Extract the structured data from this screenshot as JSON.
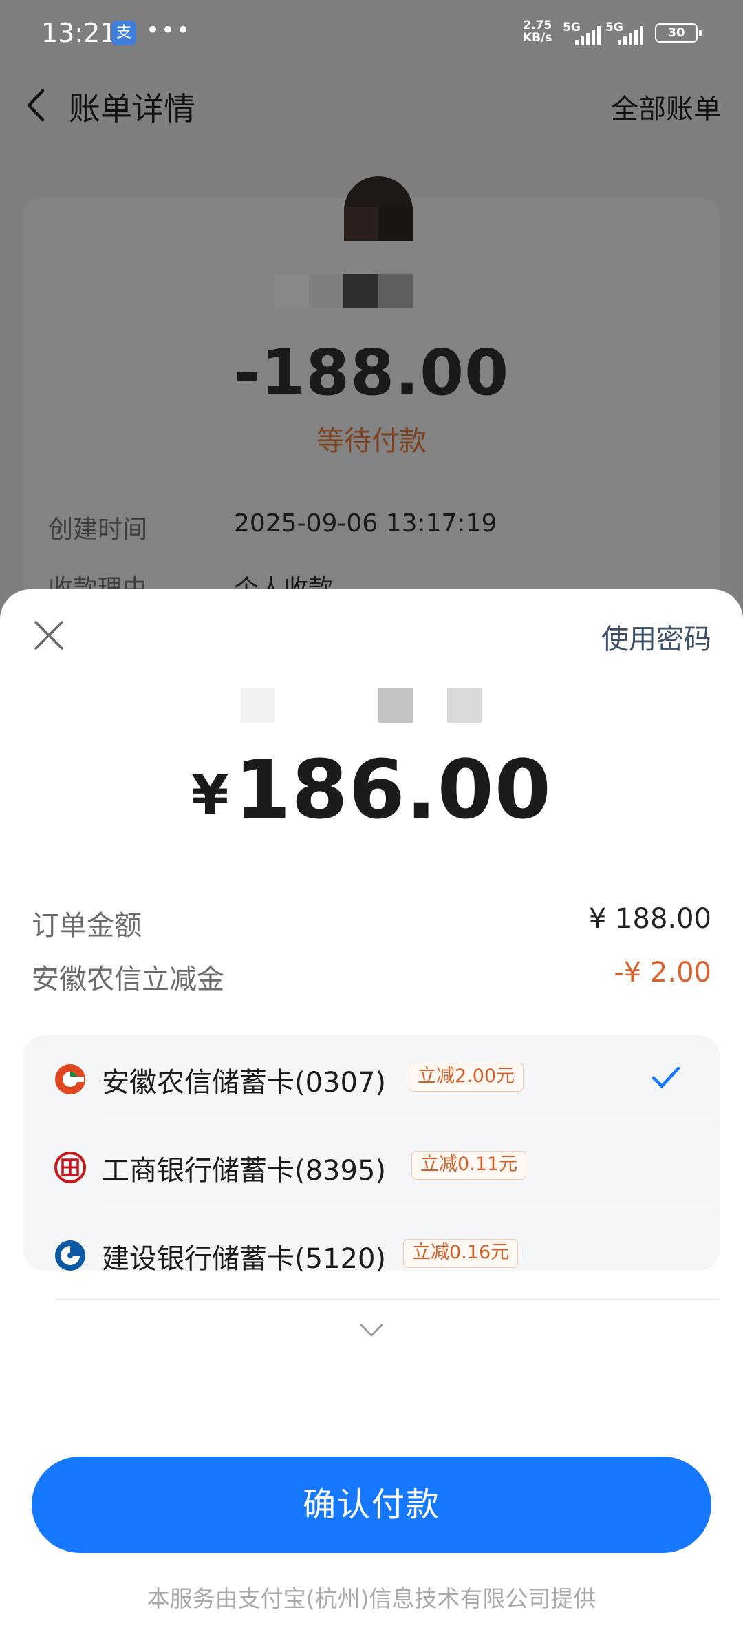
{
  "status_bar": {
    "time": "13:21",
    "app_icon_glyph": "支",
    "dots": "•••",
    "net_speed_value": "2.75",
    "net_speed_unit": "KB/s",
    "signal1_label": "5G",
    "signal2_label": "5G",
    "battery": "30"
  },
  "header": {
    "title": "账单详情",
    "right_link": "全部账单"
  },
  "bill": {
    "amount": "-188.00",
    "status": "等待付款",
    "rows": [
      {
        "label": "创建时间",
        "value": "2025-09-06 13:17:19"
      },
      {
        "label": "收款理由",
        "value": "个人收款"
      }
    ]
  },
  "payment_sheet": {
    "use_password": "使用密码",
    "currency": "¥",
    "amount": "186.00",
    "order_amount_label": "订单金额",
    "order_amount_value": "¥ 188.00",
    "discount_label": "安徽农信立减金",
    "discount_value": "-¥ 2.00",
    "cards": [
      {
        "name": "安徽农信储蓄卡(0307)",
        "promo": "立减2.00元",
        "selected": true,
        "icon": "ahnx-bank-icon"
      },
      {
        "name": "工商银行储蓄卡(8395)",
        "promo": "立减0.11元",
        "selected": false,
        "icon": "icbc-bank-icon"
      },
      {
        "name": "建设银行储蓄卡(5120)",
        "promo": "立减0.16元",
        "selected": false,
        "icon": "ccb-bank-icon"
      }
    ],
    "confirm_button": "确认付款",
    "footer": "本服务由支付宝(杭州)信息技术有限公司提供"
  },
  "colors": {
    "primary_button": "#1677ff",
    "discount_text": "#d8622d",
    "status_text": "#7b4321",
    "check": "#1677ff"
  }
}
